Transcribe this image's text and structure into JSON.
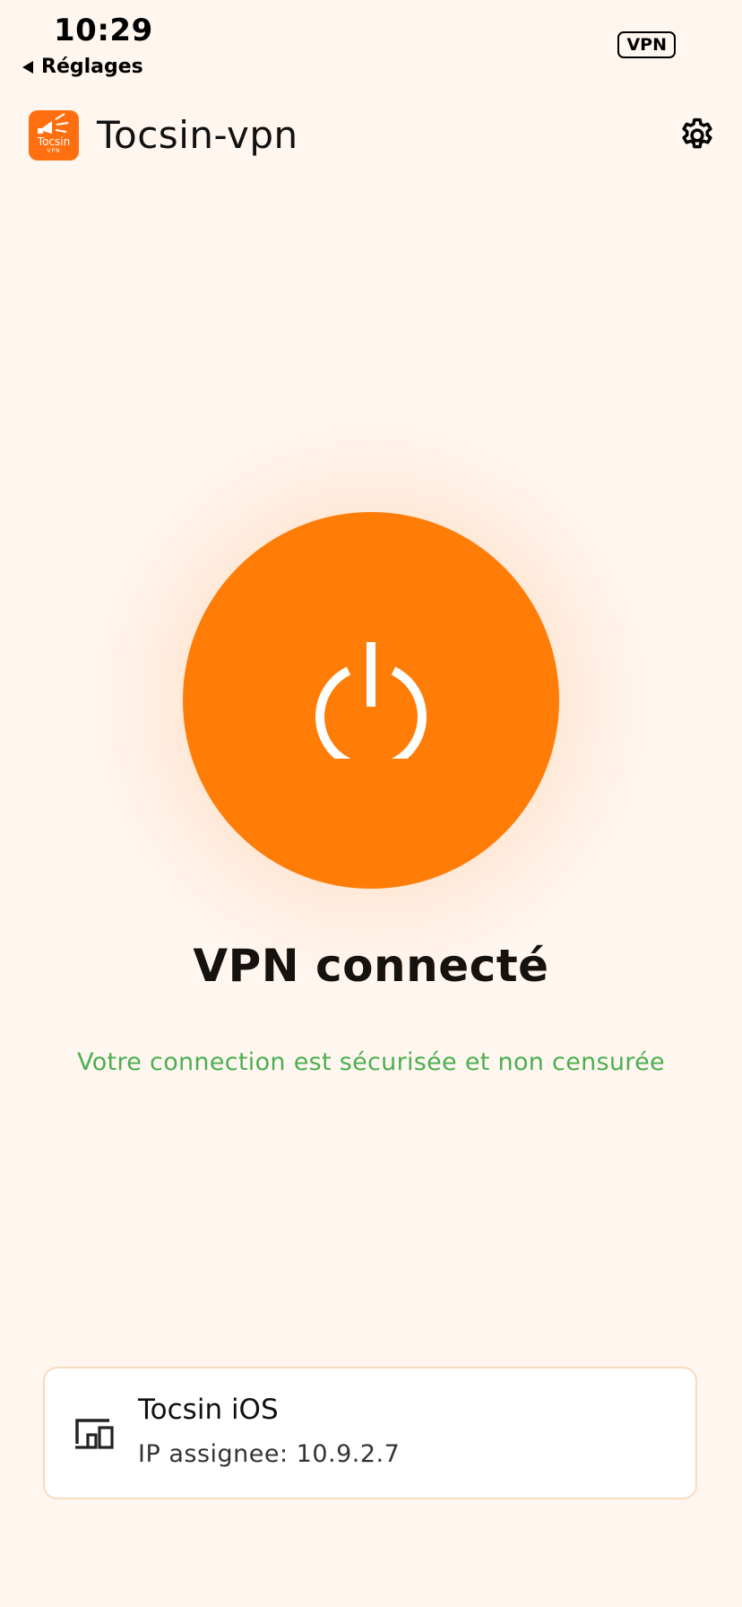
{
  "status_bar": {
    "time": "10:29",
    "back_label": "Réglages",
    "vpn_badge": "VPN"
  },
  "header": {
    "app_title": "Tocsin-vpn",
    "logo_text": "Tocsin",
    "logo_subtext": "VPN"
  },
  "main": {
    "status_title": "VPN connecté",
    "status_subtitle": "Votre connection est sécurisée et non censurée"
  },
  "device": {
    "name": "Tocsin iOS",
    "ip": "IP assignee: 10.9.2.7"
  },
  "colors": {
    "background": "#fff6f0",
    "accent": "#ff7c07",
    "success": "#4caf50",
    "card_border": "#f8dcc0"
  },
  "icons": {
    "back": "back-triangle-icon",
    "settings": "gear-icon",
    "power": "power-icon",
    "device": "devices-icon"
  }
}
